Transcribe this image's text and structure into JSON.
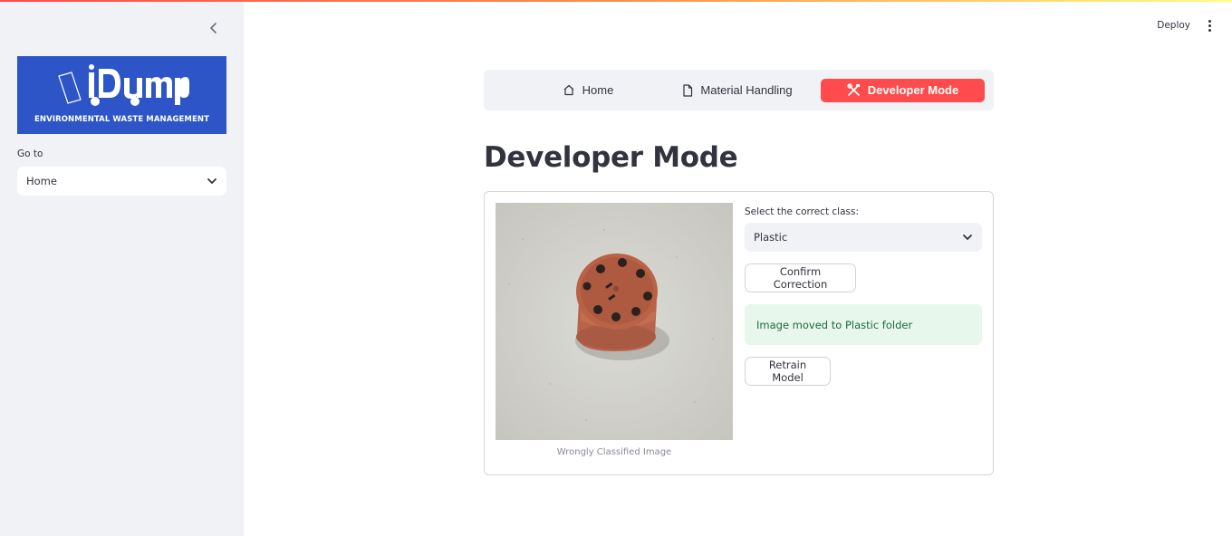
{
  "header": {
    "deploy_label": "Deploy",
    "accent_gradient": [
      "#ff4b4b",
      "#fffd80"
    ]
  },
  "sidebar": {
    "logo": {
      "brand": "iDump",
      "subtitle": "ENVIRONMENTAL WASTE MANAGEMENT",
      "background": "#2d55c8"
    },
    "goto_label": "Go to",
    "goto_value": "Home"
  },
  "nav": {
    "items": [
      {
        "label": "Home",
        "icon": "home-icon",
        "active": false
      },
      {
        "label": "Material Handling",
        "icon": "document-icon",
        "active": false
      },
      {
        "label": "Developer Mode",
        "icon": "tools-icon",
        "active": true
      }
    ],
    "active_color": "#ff4b4b"
  },
  "main": {
    "title": "Developer Mode",
    "image_caption": "Wrongly Classified Image",
    "class_label": "Select the correct class:",
    "class_value": "Plastic",
    "confirm_label": "Confirm Correction",
    "alert_text": "Image moved to Plastic folder",
    "retrain_label": "Retrain Model"
  }
}
